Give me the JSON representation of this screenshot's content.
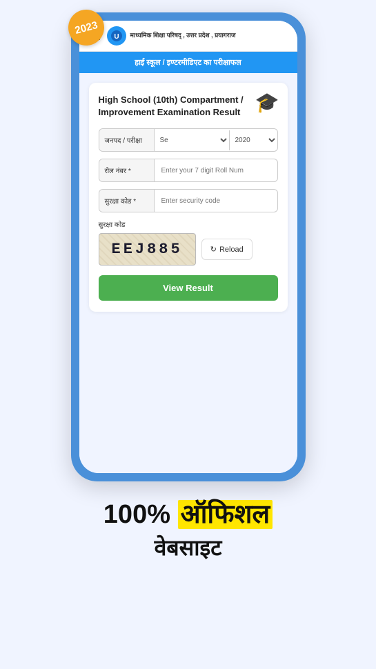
{
  "badge": "2023",
  "header": {
    "org_name": "माध्यमिक शिक्षा परिषद् , उत्तर प्रदेश , प्रयागराज"
  },
  "banner": {
    "text": "हाई स्कूल / इण्टरमीडिएट का परीक्षाफल"
  },
  "card": {
    "title": "High School (10th) Compartment / Improvement Examination Result",
    "janpad_label": "जनपद / परीक्षा",
    "janpad_option": "Se",
    "year_option": "2020",
    "roll_label": "रोल नंबर *",
    "roll_placeholder": "Enter your 7 digit Roll Num",
    "security_label": "सुरक्षा कोड *",
    "security_placeholder": "Enter security code",
    "captcha_section_label": "सुरक्षा कोड",
    "captcha_code": "EEJ885",
    "reload_label": "Reload",
    "view_result_label": "View Result"
  },
  "bottom": {
    "line1_normal": "100%",
    "line1_highlight": "ऑफिशल",
    "line2": "वेबसाइट"
  }
}
